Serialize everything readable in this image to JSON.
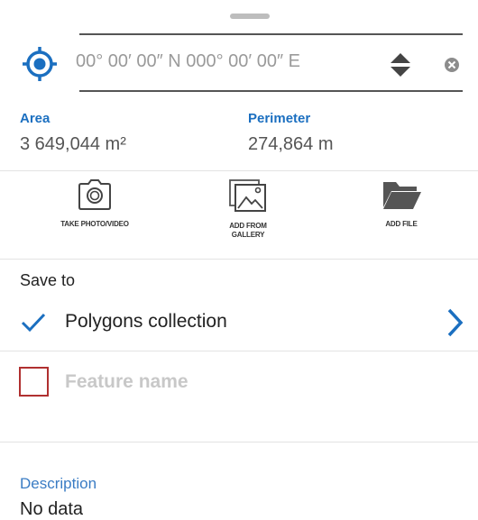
{
  "coordinates": {
    "value": "00° 00′ 00″ N 000° 00′ 00″ E"
  },
  "stats": {
    "area_label": "Area",
    "area_value": "3 649,044 m²",
    "perimeter_label": "Perimeter",
    "perimeter_value": "274,864 m"
  },
  "actions": {
    "take_photo": "TAKE PHOTO/VIDEO",
    "gallery_line1": "ADD FROM",
    "gallery_line2": "GALLERY",
    "add_file": "ADD FILE"
  },
  "save": {
    "label": "Save to",
    "collection": "Polygons collection"
  },
  "feature": {
    "placeholder": "Feature name"
  },
  "description": {
    "label": "Description",
    "value": "No data"
  },
  "icons": [
    "locate-icon",
    "sort-icon",
    "clear-icon",
    "camera-icon",
    "gallery-icon",
    "folder-icon",
    "check-icon",
    "chevron-right-icon"
  ],
  "colors": {
    "accent": "#1b6fc0",
    "checkbox_border": "#b03030",
    "placeholder": "#c8c8c8"
  }
}
